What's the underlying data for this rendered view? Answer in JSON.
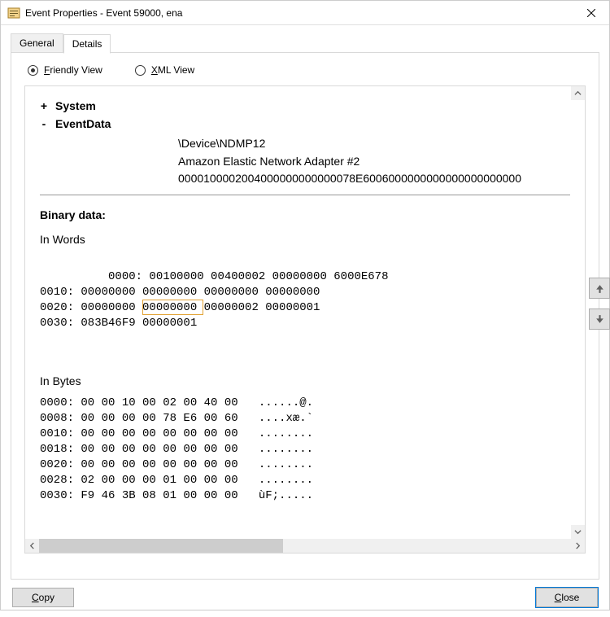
{
  "window": {
    "title": "Event Properties - Event 59000, ena"
  },
  "tabs": {
    "general": "General",
    "details": "Details"
  },
  "views": {
    "friendly_prefix": "F",
    "friendly_rest": "riendly View",
    "xml_prefix": "X",
    "xml_rest": "ML View"
  },
  "tree": {
    "system_label": "System",
    "eventdata_label": "EventData",
    "values": {
      "device": "\\Device\\NDMP12",
      "adapter": "Amazon Elastic Network Adapter #2",
      "hex": "0000100002004000000000000078E6006000000000000000000000"
    }
  },
  "binary": {
    "section_title": "Binary data:",
    "words_title": "In Words",
    "bytes_title": "In Bytes",
    "words": "0000: 00100000 00400002 00000000 6000E678\n0010: 00000000 00000000 00000000 00000000\n0020: 00000000 00000000 00000002 00000001\n0030: 083B46F9 00000001",
    "bytes": "0000: 00 00 10 00 02 00 40 00   ......@.\n0008: 00 00 00 00 78 E6 00 60   ....xæ.`\n0010: 00 00 00 00 00 00 00 00   ........\n0018: 00 00 00 00 00 00 00 00   ........\n0020: 00 00 00 00 00 00 00 00   ........\n0028: 02 00 00 00 01 00 00 00   ........\n0030: F9 46 3B 08 01 00 00 00   ùF;....."
  },
  "footer": {
    "copy_prefix": "C",
    "copy_rest": "opy",
    "close_prefix": "C",
    "close_rest": "lose"
  }
}
